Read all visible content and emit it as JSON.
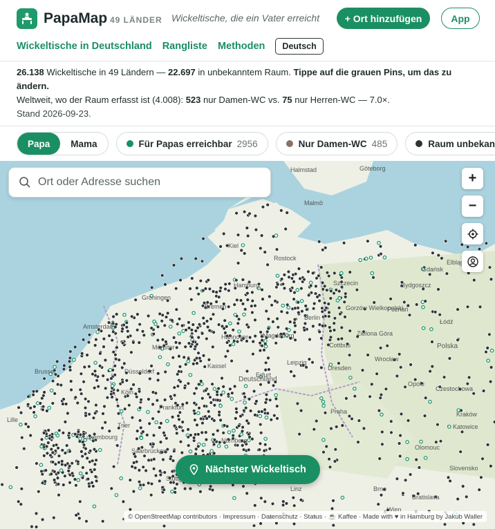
{
  "header": {
    "brand": "PapaMap",
    "countries_badge": "49 LÄNDER",
    "tagline": "Wickeltische, die ein Vater erreicht",
    "add_button": "+ Ort hinzufügen",
    "app_button": "App"
  },
  "nav": {
    "items": [
      "Wickeltische in Deutschland",
      "Rangliste",
      "Methoden"
    ],
    "language": "Deutsch"
  },
  "info": {
    "total": "26.138",
    "total_text": "Wickeltische in 49 Ländern —",
    "unknown": "22.697",
    "unknown_text": "in unbekanntem Raum.",
    "cta_text": "Tippe auf die grauen Pins, um das zu ändern.",
    "line2_prefix": "Weltweit, wo der Raum erfasst ist (4.008):",
    "women_only": "523",
    "women_text": "nur Damen-WC vs.",
    "men_only": "75",
    "men_text": "nur Herren-WC — 7.0×.",
    "stand": "Stand 2026-09-23."
  },
  "filters": {
    "mode_on": "Papa",
    "mode_off": "Mama",
    "chips": [
      {
        "label": "Für Papas erreichbar",
        "count": "2956",
        "color": "#12916a"
      },
      {
        "label": "Nur Damen-WC",
        "count": "485",
        "color": "#8a7268"
      },
      {
        "label": "Raum unbekannt",
        "count": "",
        "color": "#2e3436"
      }
    ]
  },
  "map": {
    "search_placeholder": "Ort oder Adresse suchen",
    "zoom_in": "+",
    "zoom_out": "−",
    "nearest_button": "Nächster Wickeltisch",
    "attribution": "© OpenStreetMap contributors · Impressum · Datenschutz · Status · ☕ Kaffee · Made with ♥ in Hamburg by Jakub Waller",
    "labels": {
      "l1": "Deutschland",
      "l2": "Polska",
      "l3": "Berlin",
      "l4": "Hamburg",
      "l5": "Bremen",
      "l6": "Hannover",
      "l7": "Leipzig",
      "l8": "Dresden",
      "l9": "Praha",
      "l10": "Bratislava",
      "l11": "Wrocław",
      "l12": "Gdańsk",
      "l13": "Szczecin",
      "l14": "Frankfurt",
      "l15": "Amsterdam",
      "l16": "Brussel",
      "l17": "Luxembourg",
      "l18": "Saarbrücken",
      "l19": "Slovensko",
      "l20": "Poznań",
      "l21": "Łódź",
      "l22": "Kraków",
      "l23": "Elbląg",
      "l24": "Groningen",
      "l25": "Kiel",
      "l26": "Rostock",
      "l27": "Halmstad",
      "l28": "Malmö",
      "l29": "Lille",
      "l30": "Trier",
      "l31": "Erfurt",
      "l32": "Kassel",
      "l33": "Olomouc",
      "l34": "Czestochowa",
      "l35": "Katowice",
      "l36": "Bydgoszcz",
      "l37": "Gorzów Wielkopolski",
      "l38": "Göteborg",
      "l39": "Düsseldorf",
      "l40": "Köln",
      "l41": "Münster",
      "l42": "Magdeburg",
      "l43": "Cottbus",
      "l44": "Zielona Góra",
      "l45": "Opole",
      "l46": "Brno",
      "l47": "Linz",
      "l48": "Wien",
      "l49": "Nürnberg",
      "l50": "Stuttgart"
    }
  },
  "colors": {
    "accent": "#1a8f63",
    "sea": "#aad3df",
    "land": "#eef0e6",
    "pin_unknown": "#2e3436",
    "pin_papa": "#12916a"
  }
}
